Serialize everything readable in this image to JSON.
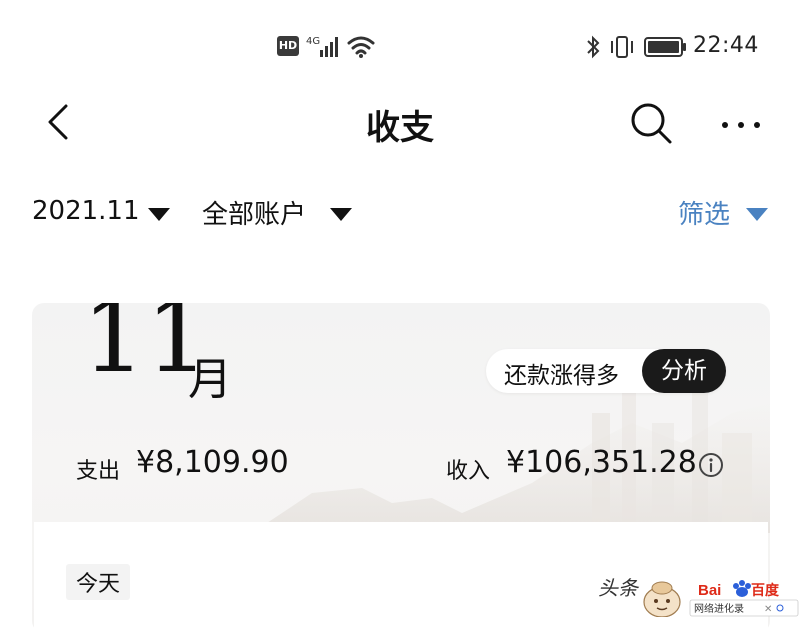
{
  "status_bar": {
    "hd_badge": "HD",
    "network": "4G",
    "time": "22:44"
  },
  "top_bar": {
    "title": "收支"
  },
  "filter_bar": {
    "month": "2021.11",
    "account": "全部账户",
    "filter": "筛选",
    "filter_color": "#4a82c1"
  },
  "summary_card": {
    "month_number": "11",
    "month_unit": "月",
    "promo_text": "还款涨得多",
    "analyze_button": "分析",
    "expense_label": "支出",
    "expense_amount": "¥8,109.90",
    "income_label": "收入",
    "income_amount": "¥106,351.28",
    "info_icon": "info-icon"
  },
  "list": {
    "section_label": "今天"
  },
  "watermarks": {
    "toutiao": "头条",
    "baidu_logo": "Bai百度",
    "baidu_caption": "网络进化录"
  }
}
